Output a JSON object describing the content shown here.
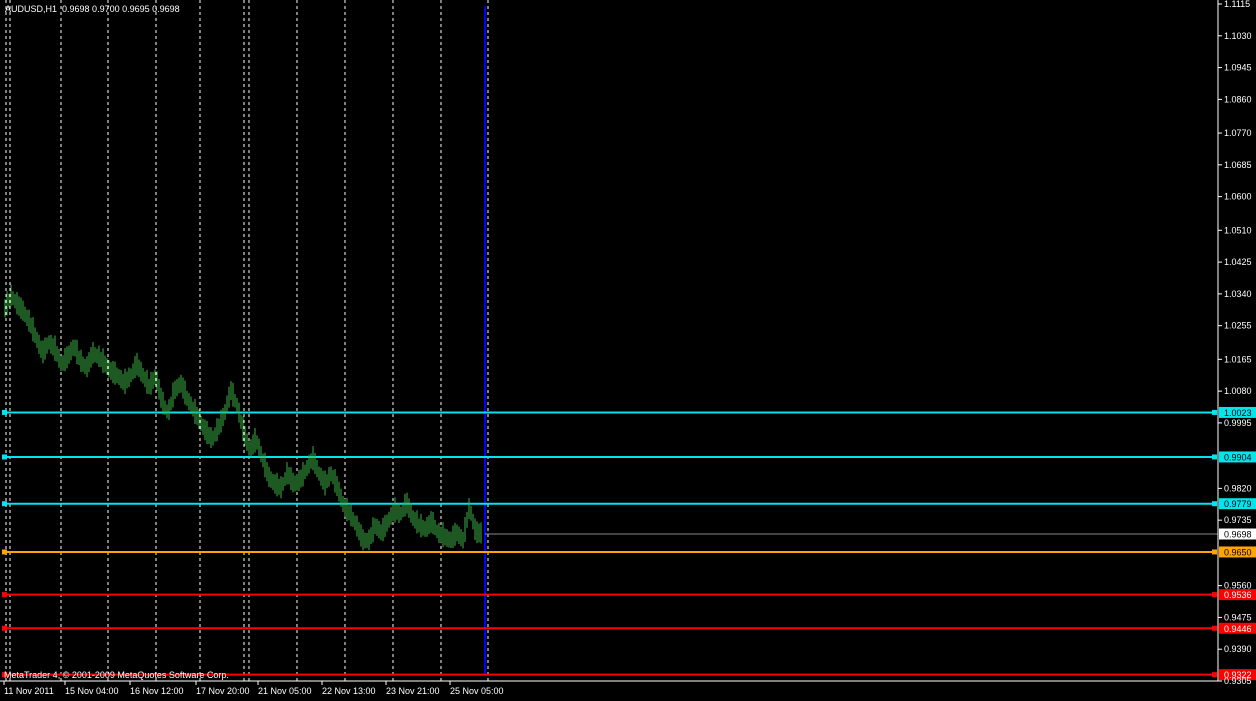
{
  "header": {
    "symbol_tf": "AUDUSD,H1",
    "ohlc": "0.9698 0.9700 0.9695 0.9698"
  },
  "copyright": "MetaTrader 4, © 2001-2009 MetaQuotes Software Corp.",
  "colors": {
    "background": "#000000",
    "candles": "#3cb043",
    "axis": "#ffffff",
    "separator": "#ffffff",
    "period_line": "#0000ff",
    "cyan": "#00e5ee",
    "orange": "#ffa500",
    "red": "#ff0000"
  },
  "chart_data": {
    "type": "line",
    "symbol": "AUDUSD",
    "timeframe": "H1",
    "ylim": [
      0.9305,
      1.1115
    ],
    "y_ticks": [
      "1.1115",
      "1.1030",
      "1.0945",
      "1.0860",
      "1.0770",
      "1.0685",
      "1.0600",
      "1.0510",
      "1.0425",
      "1.0340",
      "1.0255",
      "1.0165",
      "1.0080",
      "0.9995",
      "0.9820",
      "0.9735",
      "0.9560",
      "0.9475",
      "0.9390",
      "0.9305"
    ],
    "x_ticks": [
      "11 Nov 2011",
      "15 Nov 04:00",
      "16 Nov 12:00",
      "17 Nov 20:00",
      "21 Nov 05:00",
      "22 Nov 13:00",
      "23 Nov 21:00",
      "25 Nov 05:00"
    ],
    "current_price": "0.9698",
    "levels": [
      {
        "price": "1.0023",
        "color": "cyan"
      },
      {
        "price": "0.9904",
        "color": "cyan"
      },
      {
        "price": "0.9779",
        "color": "cyan"
      },
      {
        "price": "0.9650",
        "color": "orange"
      },
      {
        "price": "0.9536",
        "color": "red"
      },
      {
        "price": "0.9446",
        "color": "red"
      },
      {
        "price": "0.9322",
        "color": "red"
      }
    ],
    "price_series": [
      1.03,
      1.0335,
      1.031,
      1.029,
      1.026,
      1.022,
      1.018,
      1.021,
      1.019,
      1.015,
      1.017,
      1.02,
      1.016,
      1.014,
      1.018,
      1.017,
      1.015,
      1.013,
      1.012,
      1.01,
      1.012,
      1.015,
      1.012,
      1.009,
      1.012,
      1.005,
      1.002,
      1.008,
      1.01,
      1.006,
      1.003,
      1.0,
      0.997,
      0.995,
      0.998,
      1.002,
      1.008,
      1.004,
      0.997,
      0.992,
      0.995,
      0.99,
      0.985,
      0.983,
      0.982,
      0.986,
      0.983,
      0.984,
      0.987,
      0.99,
      0.986,
      0.983,
      0.986,
      0.982,
      0.977,
      0.975,
      0.972,
      0.968,
      0.968,
      0.972,
      0.97,
      0.973,
      0.976,
      0.975,
      0.978,
      0.974,
      0.972,
      0.971,
      0.973,
      0.97,
      0.969,
      0.968,
      0.97,
      0.968,
      0.977,
      0.97,
      0.9698
    ]
  }
}
